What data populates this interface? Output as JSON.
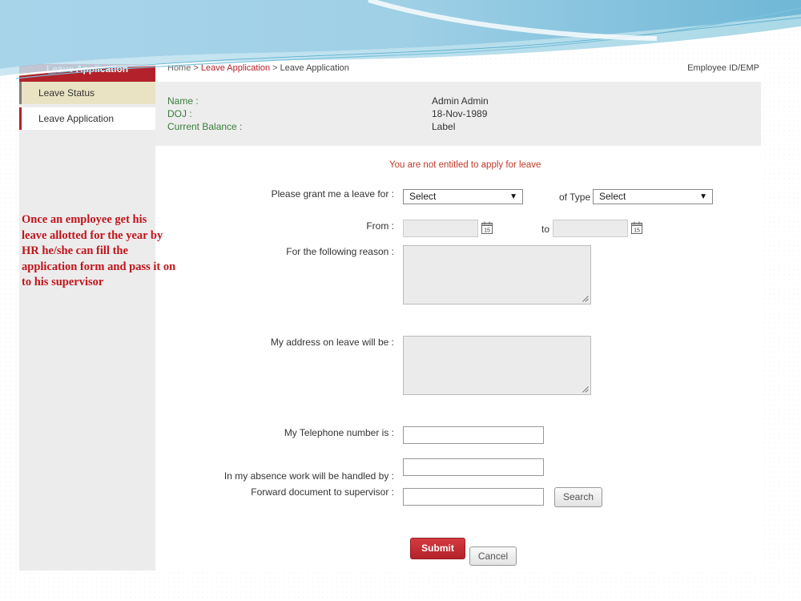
{
  "sidebar": {
    "header": "Leave Application",
    "items": [
      {
        "label": "Leave Status"
      },
      {
        "label": "Leave Application"
      }
    ]
  },
  "breadcrumb": {
    "home": "Home",
    "section": "Leave Application",
    "current": "Leave Application"
  },
  "employee_id_label": "Employee ID/EMP",
  "info": {
    "name_label": "Name :",
    "name_value": "Admin Admin",
    "doj_label": "DOJ :",
    "doj_value": "18-Nov-1989",
    "balance_label": "Current Balance :",
    "balance_value": "Label"
  },
  "form": {
    "message": "You are not entitled to apply for leave",
    "grant_label": "Please grant me a leave for :",
    "grant_select": "Select",
    "type_label": "of Type",
    "type_select": "Select",
    "from_label": "From :",
    "to_label": "to",
    "calendar_day": "15",
    "reason_label": "For the following reason :",
    "address_label": "My address on leave will be :",
    "telephone_label": "My Telephone number is :",
    "absence_label": "In my absence work will be handled by :",
    "forward_label": "Forward document to supervisor :",
    "search_button": "Search",
    "submit_button": "Submit",
    "cancel_button": "Cancel"
  },
  "annotation": {
    "lines": [
      "Once an employee get his",
      "leave allotted for the year by",
      "HR he/she can fill the",
      "application form and pass it on",
      "to his supervisor"
    ]
  },
  "colors": {
    "brand_red": "#b3222a",
    "status_bg": "#e9e3c3",
    "panel_bg": "#ededed",
    "label_green": "#3a7d3a"
  }
}
